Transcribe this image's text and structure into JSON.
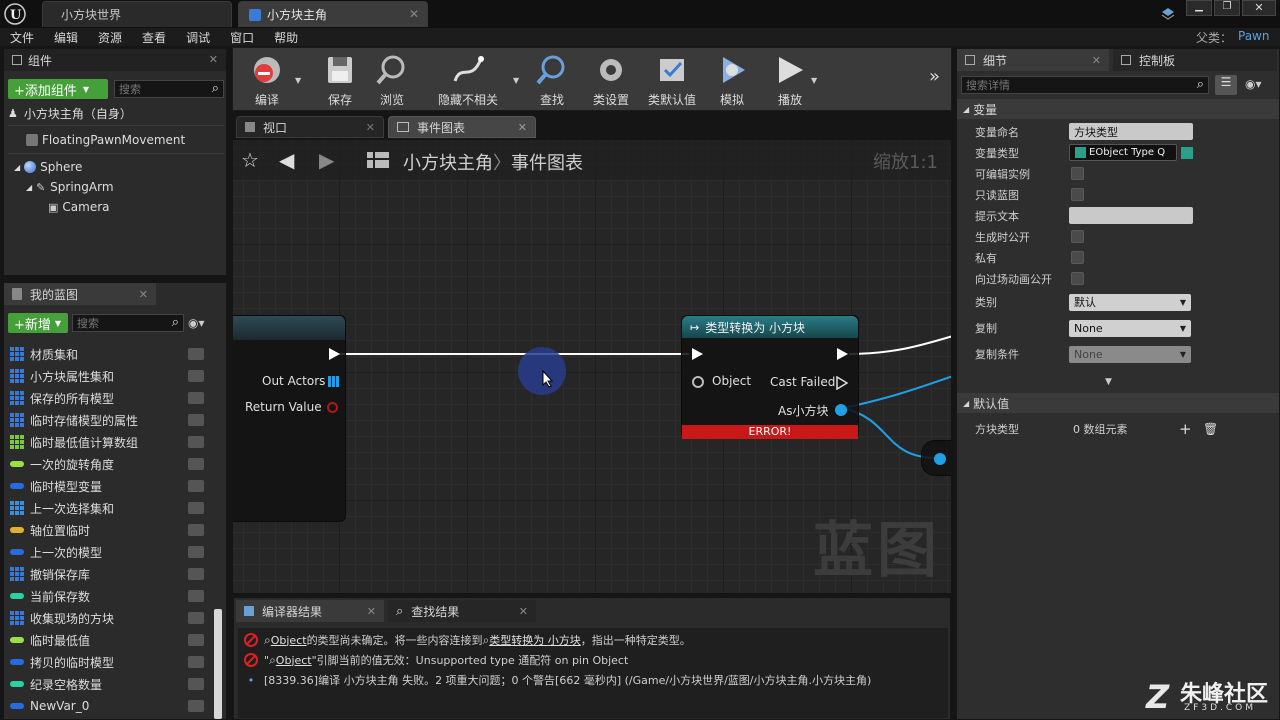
{
  "window": {
    "tabs": [
      {
        "label": "小方块世界"
      },
      {
        "label": "小方块主角"
      }
    ],
    "parent_label": "父类：",
    "parent_value": "Pawn"
  },
  "menu": [
    "文件",
    "编辑",
    "资源",
    "查看",
    "调试",
    "窗口",
    "帮助"
  ],
  "components": {
    "title": "组件",
    "add_button": "+添加组件",
    "search_placeholder": "搜索",
    "self_item": "小方块主角（自身）",
    "items": [
      "FloatingPawnMovement",
      "Sphere",
      "SpringArm",
      "Camera"
    ]
  },
  "my_blueprint": {
    "title": "我的蓝图",
    "new_button": "+新增",
    "search_placeholder": "搜索",
    "variables": [
      {
        "label": "材质集和",
        "color": "#3a78d8",
        "kind": "grid"
      },
      {
        "label": "小方块属性集和",
        "color": "#3a78d8",
        "kind": "grid"
      },
      {
        "label": "保存的所有模型",
        "color": "#3a78d8",
        "kind": "grid"
      },
      {
        "label": "临时存储模型的属性",
        "color": "#3a78d8",
        "kind": "grid"
      },
      {
        "label": "临时最低值计算数组",
        "color": "#7ac93a",
        "kind": "grid"
      },
      {
        "label": "一次的旋转角度",
        "color": "#9ae04a",
        "kind": "pill"
      },
      {
        "label": "临时模型变量",
        "color": "#2a6ae0",
        "kind": "pill"
      },
      {
        "label": "上一次选择集和",
        "color": "#3a90e0",
        "kind": "grid"
      },
      {
        "label": "轴位置临时",
        "color": "#e0b030",
        "kind": "pill"
      },
      {
        "label": "上一次的模型",
        "color": "#2a6ae0",
        "kind": "pill"
      },
      {
        "label": "撤销保存库",
        "color": "#3a78d8",
        "kind": "grid"
      },
      {
        "label": "当前保存数",
        "color": "#2ad0a0",
        "kind": "pill"
      },
      {
        "label": "收集现场的方块",
        "color": "#3a78d8",
        "kind": "grid"
      },
      {
        "label": "临时最低值",
        "color": "#9ae04a",
        "kind": "pill"
      },
      {
        "label": "拷贝的临时模型",
        "color": "#2a6ae0",
        "kind": "pill"
      },
      {
        "label": "纪录空格数量",
        "color": "#2ad0a0",
        "kind": "pill"
      },
      {
        "label": "NewVar_0",
        "color": "#2a6ae0",
        "kind": "pill"
      }
    ]
  },
  "toolbar": [
    {
      "label": "编译",
      "icon": "compile-icon"
    },
    {
      "label": "保存",
      "icon": "save-icon"
    },
    {
      "label": "浏览",
      "icon": "browse-icon"
    },
    {
      "label": "隐藏不相关",
      "icon": "hide-unrelated-icon"
    },
    {
      "label": "查找",
      "icon": "find-icon"
    },
    {
      "label": "类设置",
      "icon": "class-settings-icon"
    },
    {
      "label": "类默认值",
      "icon": "class-defaults-icon"
    },
    {
      "label": "模拟",
      "icon": "simulate-icon"
    },
    {
      "label": "播放",
      "icon": "play-icon"
    }
  ],
  "editor_tabs": {
    "viewport": "视口",
    "event_graph": "事件图表"
  },
  "graph": {
    "breadcrumb_root": "小方块主角",
    "breadcrumb_sep": "〉",
    "breadcrumb_leaf": "事件图表",
    "zoom": "缩放1:1",
    "watermark": "蓝图",
    "left_node": {
      "out_actors": "Out Actors",
      "return_value": "Return Value"
    },
    "cast_node": {
      "title": "类型转换为 小方块",
      "object_pin": "Object",
      "cast_failed": "Cast Failed",
      "as_pin": "As小方块",
      "error": "ERROR!"
    }
  },
  "details": {
    "tab_details": "细节",
    "tab_palette": "控制板",
    "search_placeholder": "搜索详情",
    "section_variable": "变量",
    "rows": {
      "var_name_label": "变量命名",
      "var_name_value": "方块类型",
      "var_type_label": "变量类型",
      "var_type_value": "EObject Type Q",
      "editable_label": "可编辑实例",
      "readonly_label": "只读蓝图",
      "tooltip_label": "提示文本",
      "expose_spawn_label": "生成时公开",
      "private_label": "私有",
      "expose_cinematics_label": "向过场动画公开",
      "category_label": "类别",
      "category_value": "默认",
      "replication_label": "复制",
      "replication_value": "None",
      "rep_condition_label": "复制条件",
      "rep_condition_value": "None"
    },
    "section_default": "默认值",
    "default_row_label": "方块类型",
    "default_row_value": "0 数组元素"
  },
  "bottom": {
    "tab_compiler": "编译器结果",
    "tab_find": "查找结果",
    "logs": [
      {
        "pre": "Object",
        "mid": " 的类型尚未确定。将一些内容连接到 ",
        "link": "类型转换为 小方块",
        "post": " ，指出一种特定类型。"
      },
      {
        "pre": "\"",
        "obj": "Object",
        "post": " \"引脚当前的值无效：Unsupported type 通配符 on pin Object"
      },
      {
        "text": "[8339.36]编译 小方块主角 失败。2 项重大问题；0 个警告[662 毫秒内] (/Game/小方块世界/蓝图/小方块主角.小方块主角)"
      }
    ]
  },
  "brand": {
    "name": "朱峰社区",
    "url": "ZF3D.COM"
  }
}
